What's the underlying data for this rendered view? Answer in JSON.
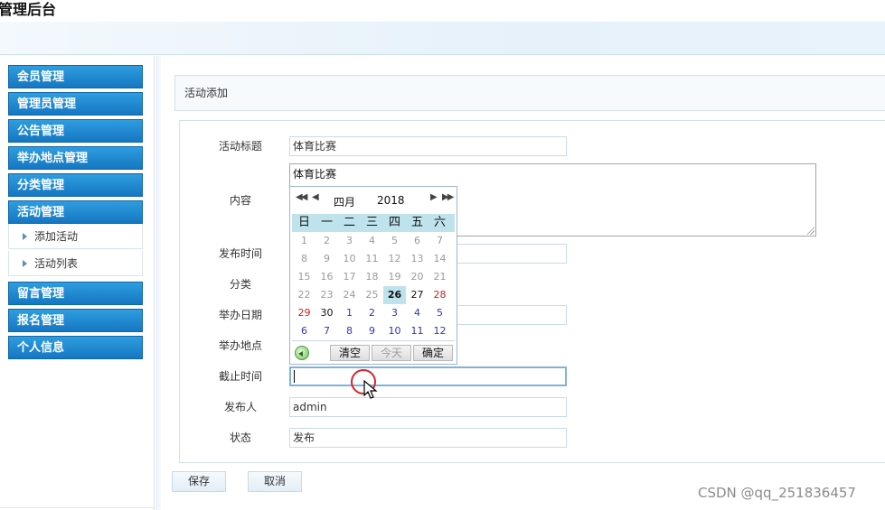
{
  "app": {
    "title": "管理后台"
  },
  "sidebar": {
    "items": [
      {
        "label": "会员管理"
      },
      {
        "label": "管理员管理"
      },
      {
        "label": "公告管理"
      },
      {
        "label": "举办地点管理"
      },
      {
        "label": "分类管理"
      },
      {
        "label": "活动管理",
        "expanded": true
      },
      {
        "label": "留言管理"
      },
      {
        "label": "报名管理"
      },
      {
        "label": "个人信息"
      }
    ],
    "submenu": [
      {
        "label": "添加活动"
      },
      {
        "label": "活动列表"
      }
    ]
  },
  "page": {
    "heading": "活动添加"
  },
  "form": {
    "title_label": "活动标题",
    "title_value": "体育比赛",
    "content_label": "内容",
    "content_value": "体育比赛",
    "publish_time_label": "发布时间",
    "category_label": "分类",
    "event_date_label": "举办日期",
    "location_label": "举办地点",
    "deadline_label": "截止时间",
    "deadline_value": "",
    "publisher_label": "发布人",
    "publisher_value": "admin",
    "status_label": "状态",
    "status_value": "发布"
  },
  "buttons": {
    "save": "保存",
    "cancel": "取消"
  },
  "calendar": {
    "prev_year": "◀◀",
    "prev_month": "◀",
    "next_month": "▶",
    "next_year": "▶▶",
    "month": "四月",
    "year": "2018",
    "weekdays": [
      "日",
      "一",
      "二",
      "三",
      "四",
      "五",
      "六"
    ],
    "days": [
      [
        "1",
        "2",
        "3",
        "4",
        "5",
        "6",
        "7"
      ],
      [
        "8",
        "9",
        "10",
        "11",
        "12",
        "13",
        "14"
      ],
      [
        "15",
        "16",
        "17",
        "18",
        "19",
        "20",
        "21"
      ],
      [
        "22",
        "23",
        "24",
        "25",
        "26",
        "27",
        "28"
      ],
      [
        "29",
        "30",
        "1",
        "2",
        "3",
        "4",
        "5"
      ],
      [
        "6",
        "7",
        "8",
        "9",
        "10",
        "11",
        "12"
      ]
    ],
    "selected_day": "26",
    "clear": "清空",
    "today": "今天",
    "ok": "确定",
    "colors": {
      "header": "#bfe3ec",
      "other_month": "#9a9a9a",
      "next_month": "#3333bb",
      "weekend_red": "#cc2222"
    }
  },
  "watermark": "CSDN @qq_251836457",
  "colors": {
    "menu_blue": "#1f86d0",
    "panel_border": "#d3e1ec",
    "cursor_ring": "#d9262a"
  }
}
